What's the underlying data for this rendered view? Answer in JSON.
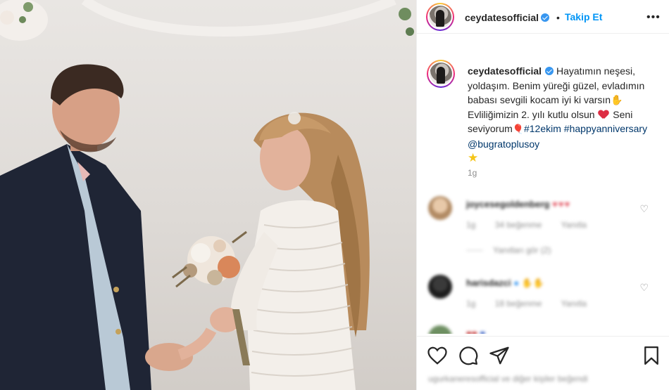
{
  "post": {
    "username": "ceydatesofficial",
    "follow_label": "Takip Et",
    "separator": "•",
    "more_label": "•••"
  },
  "caption": {
    "username": "ceydatesofficial",
    "text_1": "Hayatımın neşesi, yoldaşım. Benim yüreği güzel, evladımın babası sevgili kocam iyi ki varsın",
    "text_2": "Evliliğimizin 2. yılı kutlu olsun",
    "text_3": "Seni seviyorum",
    "hashtag_1": "#12ekim",
    "hashtag_2": "#happyanniversary",
    "mention": "@bugratoplusoy",
    "time": "1g"
  },
  "comments": [
    {
      "username": "joycesegoldenberg",
      "time": "1g",
      "likes": "34 beğenme",
      "reply": "Yanıtla",
      "view_replies": "Yanıtları gör (2)"
    },
    {
      "username": "harisdazci",
      "time": "1g",
      "likes": "18 beğenme",
      "reply": "Yanıtla"
    },
    {
      "username": ""
    }
  ],
  "footer": {
    "liked_by": "ugurkaneresofficial ve diğer kişiler beğendi"
  },
  "colors": {
    "accent": "#0095f6",
    "verified": "#3897f0",
    "secondary_text": "#8e8e8e",
    "heart": "#dd2e44"
  },
  "icons": [
    "more-icon",
    "verified-icon",
    "heart-icon",
    "comment-icon",
    "share-icon",
    "bookmark-icon"
  ]
}
